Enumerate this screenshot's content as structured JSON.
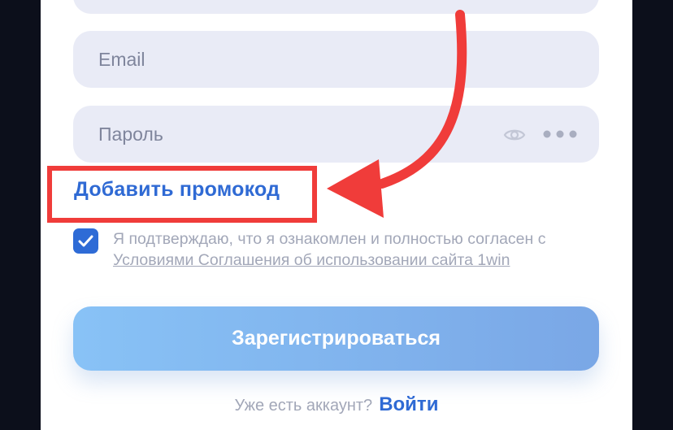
{
  "form": {
    "email_placeholder": "Email",
    "password_placeholder": "Пароль",
    "promo_link": "Добавить промокод",
    "agree_text": "Я подтверждаю, что я ознакомлен и полностью согласен с ",
    "agree_link": "Условиями Соглашения об использовании сайта 1win",
    "agree_checked": true,
    "submit_label": "Зарегистрироваться",
    "have_account_text": "Уже есть аккаунт?",
    "login_link": "Войти"
  },
  "annotation": {
    "color": "#f03c3a",
    "type": "arrow-and-box"
  },
  "colors": {
    "accent": "#2f6ad4",
    "field_bg": "#e9ebf6",
    "background": "#0c0f1b"
  },
  "icons": {
    "show_password": "eye-icon",
    "more": "dots-icon",
    "check": "check-icon"
  }
}
